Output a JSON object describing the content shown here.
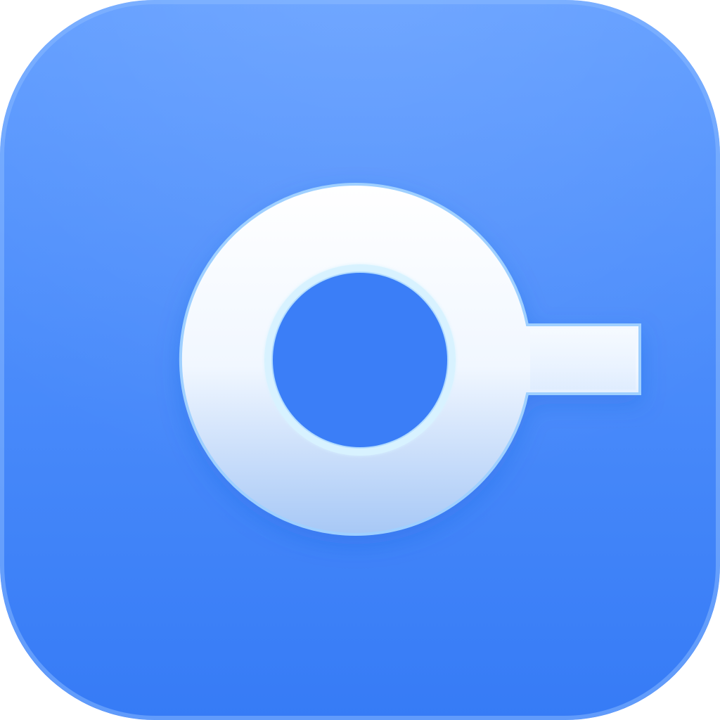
{
  "icon": {
    "name": "app-icon",
    "glyph": "ring-with-horizontal-tab-icon"
  },
  "colors": {
    "tile_top": "#5f9cff",
    "tile_bottom": "#367bf6",
    "glyph_white": "#ffffff",
    "glyph_light_blue": "#a7c8f6",
    "glyph_edge": "#9fd0ff",
    "hole_blue": "#3a7ef7"
  }
}
